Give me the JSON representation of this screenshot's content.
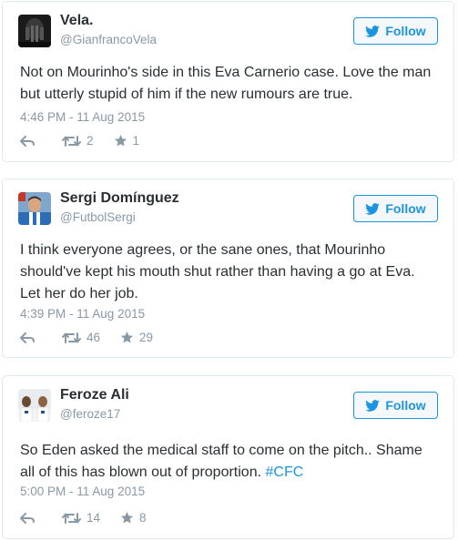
{
  "colors": {
    "accent": "#1b95e0",
    "muted": "#8899a6",
    "text": "#292f33",
    "border": "#e1e8ed"
  },
  "follow_icon": "twitter-bird-icon",
  "tweets": [
    {
      "name": "Vela.",
      "handle": "@GianfrancoVela",
      "follow_label": "Follow",
      "text": "Not on Mourinho's side in this Eva Carnerio case. Love the man but utterly stupid of him if the new rumours are true.",
      "time": "4:46 PM - 11 Aug 2015",
      "retweets": "2",
      "favorites": "1",
      "avatar_icon": "dark-avatar-icon"
    },
    {
      "name": "Sergi Domínguez",
      "handle": "@FutbolSergi",
      "follow_label": "Follow",
      "text": "I think everyone agrees, or the sane ones, that Mourinho should've kept his mouth shut rather than having a go at Eva. Let her do her job.",
      "time": "4:39 PM - 11 Aug 2015",
      "retweets": "46",
      "favorites": "29",
      "avatar_icon": "player-avatar-icon"
    },
    {
      "name": "Feroze Ali",
      "handle": "@feroze17",
      "follow_label": "Follow",
      "text": "So Eden asked the medical staff to come on the pitch.. Shame all of this has blown out of proportion.",
      "hashtag": "#CFC",
      "time": "5:00 PM - 11 Aug 2015",
      "retweets": "14",
      "favorites": "8",
      "avatar_icon": "team-avatar-icon"
    }
  ]
}
